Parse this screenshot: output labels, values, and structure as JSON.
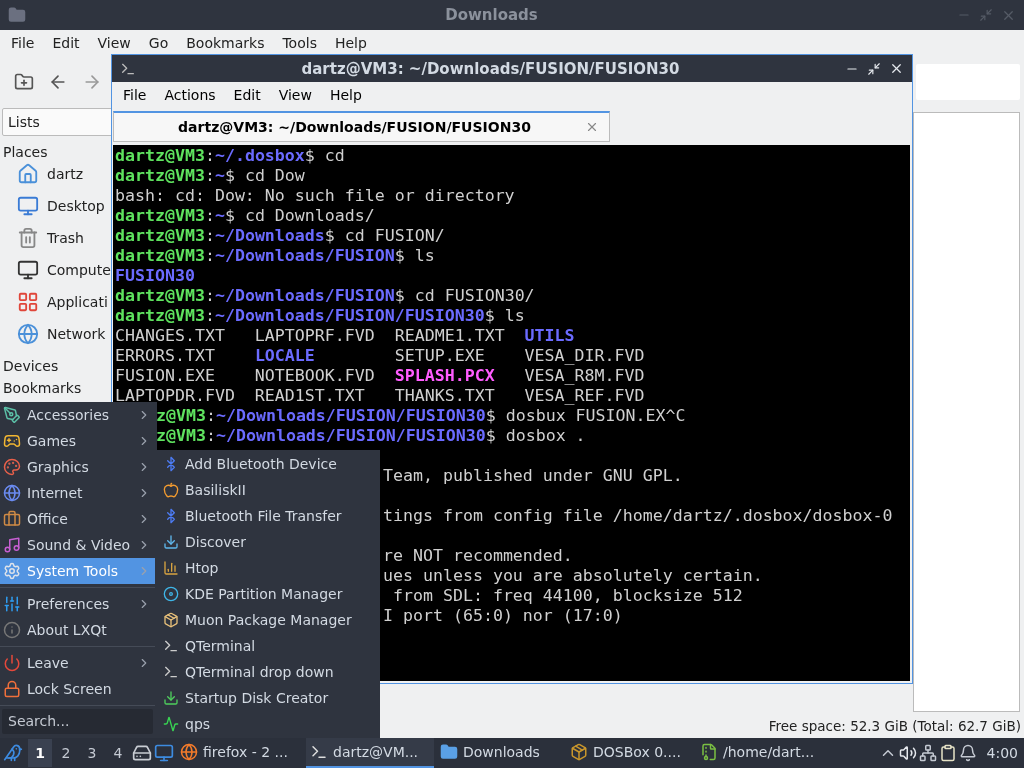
{
  "file_manager": {
    "title": "Downloads",
    "menu": [
      "File",
      "Edit",
      "View",
      "Go",
      "Bookmarks",
      "Tools",
      "Help"
    ],
    "side_pane_mode": "Lists",
    "sections": [
      {
        "title": "Places",
        "items": [
          "dartz",
          "Desktop",
          "Trash",
          "Compute",
          "Applicati",
          "Network"
        ]
      },
      {
        "title": "Devices"
      },
      {
        "title": "Bookmarks"
      }
    ],
    "status": "Free space: 52.3 GiB (Total: 62.7 GiB)"
  },
  "terminal": {
    "title": "dartz@VM3: ~/Downloads/FUSION/FUSION30",
    "menu": [
      "File",
      "Actions",
      "Edit",
      "View",
      "Help"
    ],
    "tabs": [
      {
        "label": "dartz@VM3: ~/Downloads/FUSION/FUSION30",
        "selected": true
      }
    ],
    "lines": [
      {
        "kind": "text",
        "segments": [
          {
            "kind": "user",
            "text": "dartz@VM3"
          },
          {
            "kind": "plain",
            "text": ":"
          },
          {
            "kind": "path",
            "text": "~/.dosbox"
          },
          {
            "kind": "plain",
            "text": "$ cd"
          }
        ]
      },
      {
        "kind": "text",
        "segments": [
          {
            "kind": "user",
            "text": "dartz@VM3"
          },
          {
            "kind": "plain",
            "text": ":"
          },
          {
            "kind": "path",
            "text": "~"
          },
          {
            "kind": "plain",
            "text": "$ cd Dow"
          }
        ]
      },
      {
        "kind": "text",
        "segments": [
          {
            "kind": "plain",
            "text": "bash: cd: Dow: No such file or directory"
          }
        ]
      },
      {
        "kind": "text",
        "segments": [
          {
            "kind": "user",
            "text": "dartz@VM3"
          },
          {
            "kind": "plain",
            "text": ":"
          },
          {
            "kind": "path",
            "text": "~"
          },
          {
            "kind": "plain",
            "text": "$ cd Downloads/"
          }
        ]
      },
      {
        "kind": "text",
        "segments": [
          {
            "kind": "user",
            "text": "dartz@VM3"
          },
          {
            "kind": "plain",
            "text": ":"
          },
          {
            "kind": "path",
            "text": "~/Downloads"
          },
          {
            "kind": "plain",
            "text": "$ cd FUSION/"
          }
        ]
      },
      {
        "kind": "text",
        "segments": [
          {
            "kind": "user",
            "text": "dartz@VM3"
          },
          {
            "kind": "plain",
            "text": ":"
          },
          {
            "kind": "path",
            "text": "~/Downloads/FUSION"
          },
          {
            "kind": "plain",
            "text": "$ ls"
          }
        ]
      },
      {
        "kind": "text",
        "segments": [
          {
            "kind": "dir",
            "text": "FUSION30"
          }
        ]
      },
      {
        "kind": "text",
        "segments": [
          {
            "kind": "user",
            "text": "dartz@VM3"
          },
          {
            "kind": "plain",
            "text": ":"
          },
          {
            "kind": "path",
            "text": "~/Downloads/FUSION"
          },
          {
            "kind": "plain",
            "text": "$ cd FUSION30/"
          }
        ]
      },
      {
        "kind": "text",
        "segments": [
          {
            "kind": "user",
            "text": "dartz@VM3"
          },
          {
            "kind": "plain",
            "text": ":"
          },
          {
            "kind": "path",
            "text": "~/Downloads/FUSION/FUSION30"
          },
          {
            "kind": "plain",
            "text": "$ ls"
          }
        ]
      },
      {
        "kind": "text",
        "segments": [
          {
            "kind": "plain",
            "text": "CHANGES.TXT   LAPTOPRF.FVD  README1.TXT  "
          },
          {
            "kind": "dir",
            "text": "UTILS"
          }
        ]
      },
      {
        "kind": "text",
        "segments": [
          {
            "kind": "plain",
            "text": "ERRORS.TXT    "
          },
          {
            "kind": "dir",
            "text": "LOCALE"
          },
          {
            "kind": "plain",
            "text": "        SETUP.EXE    VESA_DIR.FVD"
          }
        ]
      },
      {
        "kind": "text",
        "segments": [
          {
            "kind": "plain",
            "text": "FUSION.EXE    NOTEBOOK.FVD  "
          },
          {
            "kind": "image",
            "text": "SPLASH.PCX"
          },
          {
            "kind": "plain",
            "text": "   VESA_R8M.FVD"
          }
        ]
      },
      {
        "kind": "text",
        "segments": [
          {
            "kind": "plain",
            "text": "LAPTOPDR.FVD  READ1ST.TXT   THANKS.TXT   VESA_REF.FVD"
          }
        ]
      },
      {
        "kind": "cut_by_menu",
        "segments": [
          {
            "kind": "user",
            "text": "z@VM3"
          },
          {
            "kind": "plain",
            "text": ":"
          },
          {
            "kind": "path",
            "text": "~/Downloads/FUSION/FUSION30"
          },
          {
            "kind": "plain",
            "text": "$ dosbux FUSION.EX^C"
          }
        ]
      },
      {
        "kind": "cut_by_menu",
        "segments": [
          {
            "kind": "user",
            "text": "z@VM3"
          },
          {
            "kind": "plain",
            "text": ":"
          },
          {
            "kind": "path",
            "text": "~/Downloads/FUSION/FUSION30"
          },
          {
            "kind": "plain",
            "text": "$ dosbox ."
          }
        ]
      },
      {
        "kind": "blank"
      },
      {
        "kind": "cut_by_submenu",
        "segments": [
          {
            "kind": "plain",
            "text": "Team, published under GNU GPL."
          }
        ]
      },
      {
        "kind": "blank"
      },
      {
        "kind": "cut_by_submenu",
        "segments": [
          {
            "kind": "plain",
            "text": "tings from config file /home/dartz/.dosbox/dosbox-0"
          }
        ]
      },
      {
        "kind": "blank"
      },
      {
        "kind": "cut_by_submenu",
        "segments": [
          {
            "kind": "plain",
            "text": "re NOT recommended."
          }
        ]
      },
      {
        "kind": "cut_by_submenu",
        "segments": [
          {
            "kind": "plain",
            "text": "ues unless you are absolutely certain."
          }
        ]
      },
      {
        "kind": "cut_by_submenu",
        "segments": [
          {
            "kind": "plain",
            "text": " from SDL: freq 44100, blocksize 512"
          }
        ]
      },
      {
        "kind": "cut_by_submenu",
        "segments": [
          {
            "kind": "plain",
            "text": "I port (65:0) nor (17:0)"
          }
        ]
      }
    ]
  },
  "start_menu": {
    "sections": [
      {
        "items": [
          {
            "label": "Accessories",
            "submenu": true,
            "selected": false
          },
          {
            "label": "Games",
            "submenu": true,
            "selected": false
          },
          {
            "label": "Graphics",
            "submenu": true,
            "selected": false
          },
          {
            "label": "Internet",
            "submenu": true,
            "selected": false
          },
          {
            "label": "Office",
            "submenu": true,
            "selected": false
          },
          {
            "label": "Sound & Video",
            "submenu": true,
            "selected": false
          },
          {
            "label": "System Tools",
            "submenu": true,
            "selected": true
          }
        ]
      },
      {
        "items": [
          {
            "label": "Preferences",
            "submenu": true,
            "selected": false
          },
          {
            "label": "About LXQt",
            "submenu": false,
            "selected": false
          }
        ]
      },
      {
        "items": [
          {
            "label": "Leave",
            "submenu": true,
            "selected": false
          },
          {
            "label": "Lock Screen",
            "submenu": false,
            "selected": false
          }
        ]
      }
    ],
    "search": {
      "placeholder": "Search..."
    }
  },
  "submenu": {
    "items": [
      "Add Bluetooth Device",
      "BasiliskII",
      "Bluetooth File Transfer",
      "Discover",
      "Htop",
      "KDE Partition Manager",
      "Muon Package Manager",
      "QTerminal",
      "QTerminal drop down",
      "Startup Disk Creator",
      "qps"
    ]
  },
  "taskbar": {
    "desktops": [
      {
        "label": "1",
        "selected": true
      },
      {
        "label": "2",
        "selected": false
      },
      {
        "label": "3",
        "selected": false
      },
      {
        "label": "4",
        "selected": false
      }
    ],
    "tasks": [
      {
        "label": "firefox - 2 ...",
        "selected": false
      },
      {
        "label": "dartz@VM...",
        "selected": true
      },
      {
        "label": "Downloads",
        "selected": false
      },
      {
        "label": "DOSBox 0....",
        "selected": false
      },
      {
        "label": "/home/dart...",
        "selected": false
      }
    ],
    "clock": "4:00"
  }
}
